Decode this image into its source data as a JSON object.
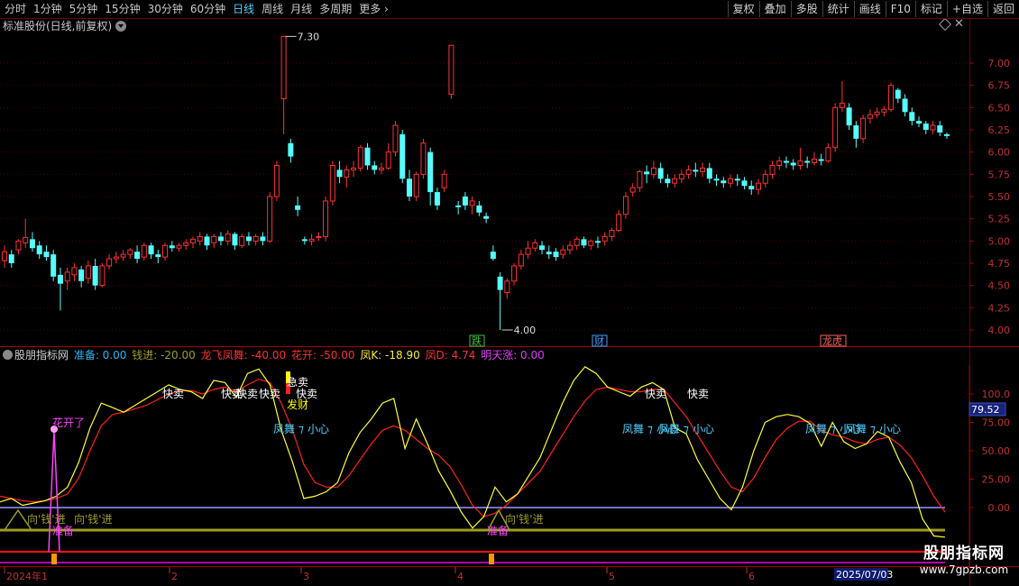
{
  "toolbar": {
    "periods": [
      "分时",
      "1分钟",
      "5分钟",
      "15分钟",
      "30分钟",
      "60分钟",
      "日线",
      "周线",
      "月线",
      "多周期",
      "更多"
    ],
    "active_period": "日线",
    "actions": [
      "复权",
      "叠加",
      "多股",
      "统计",
      "画线",
      "F10",
      "标记",
      "+自选",
      "返回"
    ]
  },
  "stock": {
    "title": "标准股份(日线,前复权)"
  },
  "price_axis": {
    "ticks": [
      "7.00",
      "6.75",
      "6.50",
      "6.25",
      "6.00",
      "5.75",
      "5.50",
      "5.25",
      "5.00",
      "4.75",
      "4.50",
      "4.25",
      "4.00"
    ]
  },
  "annotations": {
    "high": "7.30",
    "low": "4.00"
  },
  "event_tags": [
    {
      "text": "跌",
      "color": "#3fbf3f"
    },
    {
      "text": "财",
      "color": "#3fa0ff"
    },
    {
      "text": "龙虎",
      "color": "#ff6060"
    }
  ],
  "indicator": {
    "name": "股朋指标网",
    "values": [
      {
        "label": "准备",
        "value": "0.00",
        "color": "#29b6f6"
      },
      {
        "label": "钱进",
        "value": "-20.00",
        "color": "#9e9d24"
      },
      {
        "label": "龙飞凤舞",
        "value": "-40.00",
        "color": "#ff3030"
      },
      {
        "label": "花开",
        "value": "-50.00",
        "color": "#ff3030"
      },
      {
        "label": "凤K",
        "value": "-18.90",
        "color": "#ffeb3b"
      },
      {
        "label": "凤D",
        "value": "4.74",
        "color": "#ff3030"
      },
      {
        "label": "明天涨",
        "value": "0.00",
        "color": "#e040fb"
      }
    ],
    "axis_ticks": [
      "100.0",
      "75.00",
      "50.00",
      "25.00",
      "0.00"
    ],
    "current_value": "79.52",
    "signals": {
      "kuaimai": "快卖",
      "jimai": "急卖",
      "facai": "发财",
      "huakai": "花开了",
      "fengwu": "凤舞",
      "xiaoxin": "小心",
      "xiangqian": "向钱进",
      "xiangqian_alt": "向'钱'进",
      "zhunbei": "准备"
    }
  },
  "date_axis": {
    "labels": [
      "2024年1",
      "2",
      "3",
      "4",
      "5",
      "6"
    ],
    "current": "2025/07/03"
  },
  "watermark": {
    "title": "股朋指标网",
    "url": "www.7gpzb.com"
  },
  "chart_data": [
    {
      "type": "candlestick",
      "title": "标准股份(日线,前复权)",
      "ylim": [
        3.9,
        7.3
      ],
      "y_ticks": [
        4.0,
        4.25,
        4.5,
        4.75,
        5.0,
        5.25,
        5.5,
        5.75,
        6.0,
        6.25,
        6.5,
        6.75,
        7.0
      ],
      "high_marker": 7.3,
      "low_marker": 4.0,
      "candles": [
        [
          4.78,
          4.88,
          4.95,
          4.7
        ],
        [
          4.85,
          4.75,
          4.9,
          4.7
        ],
        [
          4.9,
          5.0,
          5.02,
          4.85
        ],
        [
          4.98,
          5.04,
          5.25,
          4.92
        ],
        [
          5.02,
          4.92,
          5.1,
          4.88
        ],
        [
          4.95,
          4.85,
          5.0,
          4.8
        ],
        [
          4.88,
          4.82,
          4.95,
          4.78
        ],
        [
          4.85,
          4.6,
          4.9,
          4.55
        ],
        [
          4.62,
          4.52,
          4.7,
          4.22
        ],
        [
          4.55,
          4.65,
          4.7,
          4.45
        ],
        [
          4.62,
          4.7,
          4.75,
          4.55
        ],
        [
          4.68,
          4.55,
          4.72,
          4.48
        ],
        [
          4.58,
          4.72,
          4.78,
          4.52
        ],
        [
          4.72,
          4.5,
          4.8,
          4.45
        ],
        [
          4.5,
          4.72,
          4.75,
          4.48
        ],
        [
          4.72,
          4.8,
          4.85,
          4.68
        ],
        [
          4.8,
          4.82,
          4.88,
          4.75
        ],
        [
          4.82,
          4.85,
          4.9,
          4.78
        ],
        [
          4.85,
          4.9,
          4.92,
          4.8
        ],
        [
          4.88,
          4.8,
          4.95,
          4.75
        ],
        [
          4.82,
          4.95,
          4.98,
          4.78
        ],
        [
          4.95,
          4.85,
          4.98,
          4.8
        ],
        [
          4.85,
          4.82,
          4.9,
          4.75
        ],
        [
          4.82,
          4.95,
          4.98,
          4.78
        ],
        [
          4.95,
          4.92,
          5.0,
          4.88
        ],
        [
          4.92,
          4.95,
          4.98,
          4.88
        ],
        [
          4.95,
          4.98,
          5.02,
          4.9
        ],
        [
          4.98,
          5.02,
          5.05,
          4.92
        ],
        [
          5.0,
          5.05,
          5.1,
          4.95
        ],
        [
          5.05,
          4.95,
          5.08,
          4.9
        ],
        [
          4.98,
          5.05,
          5.08,
          4.92
        ],
        [
          5.05,
          5.0,
          5.1,
          4.95
        ],
        [
          5.0,
          5.08,
          5.12,
          4.95
        ],
        [
          5.08,
          4.95,
          5.1,
          4.9
        ],
        [
          4.95,
          5.05,
          5.08,
          4.92
        ],
        [
          5.05,
          5.0,
          5.1,
          4.95
        ],
        [
          5.0,
          5.05,
          5.08,
          4.95
        ],
        [
          5.05,
          5.0,
          5.1,
          4.95
        ],
        [
          5.0,
          5.5,
          5.55,
          4.98
        ],
        [
          5.5,
          5.85,
          5.9,
          5.45
        ],
        [
          6.6,
          7.3,
          7.3,
          6.2
        ],
        [
          6.1,
          5.95,
          6.15,
          5.88
        ],
        [
          5.4,
          5.35,
          5.5,
          5.28
        ],
        [
          5.02,
          5.0,
          5.05,
          4.96
        ],
        [
          5.0,
          5.02,
          5.08,
          4.95
        ],
        [
          5.05,
          5.05,
          5.1,
          5.0
        ],
        [
          5.05,
          5.45,
          5.5,
          5.0
        ],
        [
          5.45,
          5.85,
          5.9,
          5.4
        ],
        [
          5.8,
          5.72,
          5.9,
          5.65
        ],
        [
          5.72,
          5.8,
          5.85,
          5.6
        ],
        [
          5.8,
          5.82,
          5.9,
          5.72
        ],
        [
          5.82,
          6.05,
          6.08,
          5.78
        ],
        [
          6.05,
          5.85,
          6.1,
          5.8
        ],
        [
          5.85,
          5.8,
          5.9,
          5.75
        ],
        [
          5.8,
          5.82,
          5.88,
          5.75
        ],
        [
          5.82,
          6.0,
          6.1,
          5.8
        ],
        [
          6.0,
          6.3,
          6.35,
          5.95
        ],
        [
          6.2,
          5.7,
          6.25,
          5.65
        ],
        [
          5.7,
          5.5,
          5.8,
          5.45
        ],
        [
          5.5,
          5.75,
          5.78,
          5.45
        ],
        [
          5.75,
          6.1,
          6.15,
          5.7
        ],
        [
          6.0,
          5.55,
          6.05,
          5.4
        ],
        [
          5.55,
          5.4,
          5.6,
          5.35
        ],
        [
          5.6,
          5.75,
          5.8,
          5.55
        ],
        [
          6.65,
          7.2,
          7.2,
          6.6
        ],
        [
          5.4,
          5.38,
          5.45,
          5.3
        ],
        [
          5.5,
          5.4,
          5.55,
          5.35
        ],
        [
          5.4,
          5.45,
          5.5,
          5.3
        ],
        [
          5.4,
          5.32,
          5.45,
          5.28
        ],
        [
          5.28,
          5.25,
          5.32,
          5.2
        ],
        [
          4.88,
          4.8,
          4.95,
          4.78
        ],
        [
          4.6,
          4.45,
          4.65,
          4.0
        ],
        [
          4.42,
          4.55,
          4.58,
          4.35
        ],
        [
          4.55,
          4.72,
          4.75,
          4.5
        ],
        [
          4.72,
          4.85,
          4.9,
          4.68
        ],
        [
          4.85,
          4.92,
          5.0,
          4.8
        ],
        [
          4.92,
          4.98,
          5.02,
          4.88
        ],
        [
          4.95,
          4.9,
          5.0,
          4.85
        ],
        [
          4.88,
          4.85,
          4.95,
          4.8
        ],
        [
          4.88,
          4.82,
          4.92,
          4.78
        ],
        [
          4.85,
          4.9,
          4.95,
          4.8
        ],
        [
          4.9,
          4.95,
          5.0,
          4.85
        ],
        [
          4.95,
          5.02,
          5.05,
          4.9
        ],
        [
          5.02,
          4.95,
          5.05,
          4.92
        ],
        [
          4.95,
          5.0,
          5.02,
          4.9
        ],
        [
          5.0,
          4.98,
          5.05,
          4.92
        ],
        [
          5.0,
          5.05,
          5.1,
          4.95
        ],
        [
          5.05,
          5.12,
          5.15,
          5.0
        ],
        [
          5.12,
          5.3,
          5.35,
          5.1
        ],
        [
          5.3,
          5.5,
          5.55,
          5.25
        ],
        [
          5.55,
          5.6,
          5.65,
          5.5
        ],
        [
          5.6,
          5.78,
          5.8,
          5.55
        ],
        [
          5.78,
          5.75,
          5.85,
          5.65
        ],
        [
          5.75,
          5.82,
          5.9,
          5.7
        ],
        [
          5.82,
          5.7,
          5.88,
          5.65
        ],
        [
          5.7,
          5.65,
          5.75,
          5.6
        ],
        [
          5.65,
          5.7,
          5.75,
          5.6
        ],
        [
          5.7,
          5.75,
          5.8,
          5.65
        ],
        [
          5.75,
          5.8,
          5.85,
          5.7
        ],
        [
          5.8,
          5.78,
          5.88,
          5.72
        ],
        [
          5.78,
          5.82,
          5.88,
          5.72
        ],
        [
          5.82,
          5.7,
          5.88,
          5.65
        ],
        [
          5.7,
          5.68,
          5.75,
          5.62
        ],
        [
          5.68,
          5.65,
          5.72,
          5.6
        ],
        [
          5.65,
          5.7,
          5.75,
          5.6
        ],
        [
          5.7,
          5.68,
          5.75,
          5.62
        ],
        [
          5.68,
          5.62,
          5.72,
          5.58
        ],
        [
          5.62,
          5.58,
          5.68,
          5.52
        ],
        [
          5.58,
          5.65,
          5.7,
          5.52
        ],
        [
          5.65,
          5.75,
          5.8,
          5.6
        ],
        [
          5.75,
          5.85,
          5.9,
          5.7
        ],
        [
          5.85,
          5.9,
          5.95,
          5.8
        ],
        [
          5.9,
          5.88,
          5.95,
          5.82
        ],
        [
          5.88,
          5.85,
          5.92,
          5.8
        ],
        [
          5.85,
          5.9,
          6.05,
          5.8
        ],
        [
          5.9,
          5.88,
          5.95,
          5.82
        ],
        [
          5.88,
          5.92,
          6.0,
          5.85
        ],
        [
          5.92,
          5.9,
          5.98,
          5.85
        ],
        [
          5.9,
          6.05,
          6.1,
          5.88
        ],
        [
          6.05,
          6.5,
          6.55,
          6.0
        ],
        [
          6.5,
          6.55,
          6.8,
          6.45
        ],
        [
          6.5,
          6.3,
          6.55,
          6.25
        ],
        [
          6.3,
          6.15,
          6.35,
          6.05
        ],
        [
          6.15,
          6.38,
          6.42,
          6.1
        ],
        [
          6.38,
          6.42,
          6.48,
          6.32
        ],
        [
          6.42,
          6.45,
          6.5,
          6.38
        ],
        [
          6.45,
          6.48,
          6.52,
          6.4
        ],
        [
          6.48,
          6.75,
          6.78,
          6.45
        ],
        [
          6.7,
          6.6,
          6.72,
          6.55
        ],
        [
          6.6,
          6.45,
          6.65,
          6.4
        ],
        [
          6.45,
          6.35,
          6.5,
          6.3
        ],
        [
          6.35,
          6.32,
          6.4,
          6.28
        ],
        [
          6.32,
          6.25,
          6.35,
          6.2
        ],
        [
          6.25,
          6.3,
          6.35,
          6.2
        ],
        [
          6.3,
          6.22,
          6.35,
          6.18
        ],
        [
          6.2,
          6.18,
          6.22,
          6.15
        ]
      ]
    },
    {
      "type": "line",
      "title": "股朋指标网",
      "ylim": [
        -40,
        125
      ],
      "y_ticks": [
        0,
        25,
        50,
        75,
        100
      ],
      "series": [
        {
          "name": "凤K",
          "color": "#ffff33",
          "values": [
            5,
            8,
            2,
            4,
            6,
            10,
            18,
            40,
            70,
            92,
            88,
            84,
            90,
            96,
            102,
            108,
            104,
            102,
            96,
            112,
            110,
            97,
            118,
            122,
            108,
            68,
            40,
            8,
            10,
            14,
            22,
            48,
            66,
            78,
            92,
            96,
            52,
            78,
            56,
            32,
            15,
            -4,
            -18,
            -8,
            18,
            5,
            12,
            28,
            44,
            68,
            92,
            112,
            124,
            118,
            106,
            102,
            98,
            106,
            110,
            104,
            70,
            65,
            42,
            25,
            8,
            -2,
            18,
            50,
            75,
            80,
            82,
            80,
            74,
            54,
            75,
            58,
            52,
            56,
            67,
            62,
            40,
            22,
            -10,
            -25,
            -26
          ]
        },
        {
          "name": "凤D",
          "color": "#ff2020",
          "values": [
            10,
            8,
            6,
            5,
            6,
            8,
            12,
            26,
            50,
            72,
            82,
            84,
            87,
            90,
            95,
            100,
            103,
            103,
            100,
            104,
            106,
            102,
            108,
            113,
            110,
            92,
            68,
            38,
            22,
            18,
            18,
            28,
            42,
            56,
            68,
            72,
            68,
            60,
            52,
            46,
            36,
            20,
            2,
            -8,
            -5,
            2,
            12,
            22,
            32,
            48,
            64,
            80,
            94,
            104,
            106,
            104,
            102,
            102,
            104,
            104,
            92,
            80,
            64,
            48,
            32,
            18,
            14,
            26,
            44,
            60,
            70,
            76,
            76,
            68,
            64,
            62,
            58,
            56,
            60,
            62,
            55,
            44,
            28,
            10,
            -4
          ]
        },
        {
          "name": "钱进",
          "color": "#9e9d24",
          "values": [
            -20
          ]
        },
        {
          "name": "龙飞凤舞",
          "color": "#ff3030",
          "values": [
            -40
          ]
        },
        {
          "name": "准备",
          "color": "#29b6f6",
          "values": [
            0
          ]
        }
      ]
    }
  ]
}
